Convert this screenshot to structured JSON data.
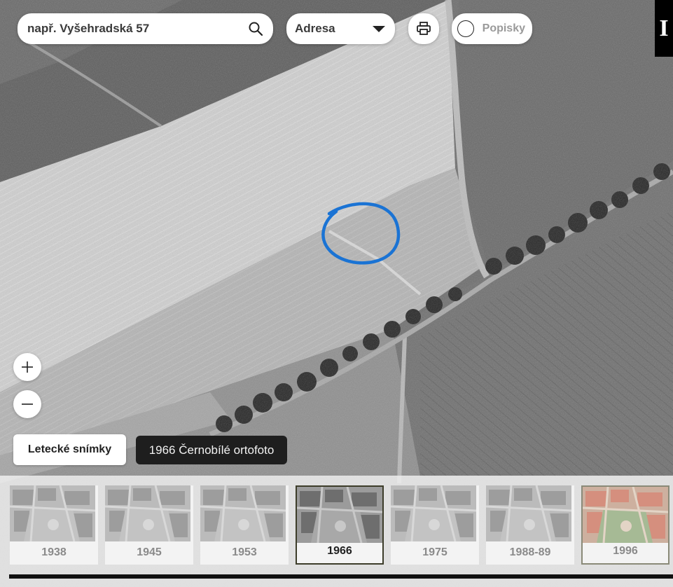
{
  "search": {
    "placeholder": "např. Vyšehradská 57"
  },
  "mode_select": {
    "selected": "Adresa"
  },
  "labels_toggle": {
    "label": "Popisky",
    "checked": false
  },
  "info_button": {
    "label": "I"
  },
  "layers": {
    "button_label": "Letecké snímky",
    "current": "1966 Černobílé ortofoto"
  },
  "timeline": {
    "active_year": "1966",
    "years": [
      {
        "label": "1938",
        "tone": "gray"
      },
      {
        "label": "1945",
        "tone": "gray"
      },
      {
        "label": "1953",
        "tone": "gray"
      },
      {
        "label": "1966",
        "tone": "gray"
      },
      {
        "label": "1975",
        "tone": "gray"
      },
      {
        "label": "1988-89",
        "tone": "gray"
      },
      {
        "label": "1996",
        "tone": "color"
      }
    ]
  },
  "colors": {
    "highlight_circle": "#1a73d4",
    "active_border": "#3d3d2a",
    "map_field_light": "#d2d2d2",
    "map_field_dark": "#777777"
  },
  "icons": {
    "search": "search-icon",
    "dropdown": "caret-down-icon",
    "print": "printer-icon",
    "toggle": "toggle-circle-icon",
    "zoom_in": "plus-icon",
    "zoom_out": "minus-icon"
  }
}
